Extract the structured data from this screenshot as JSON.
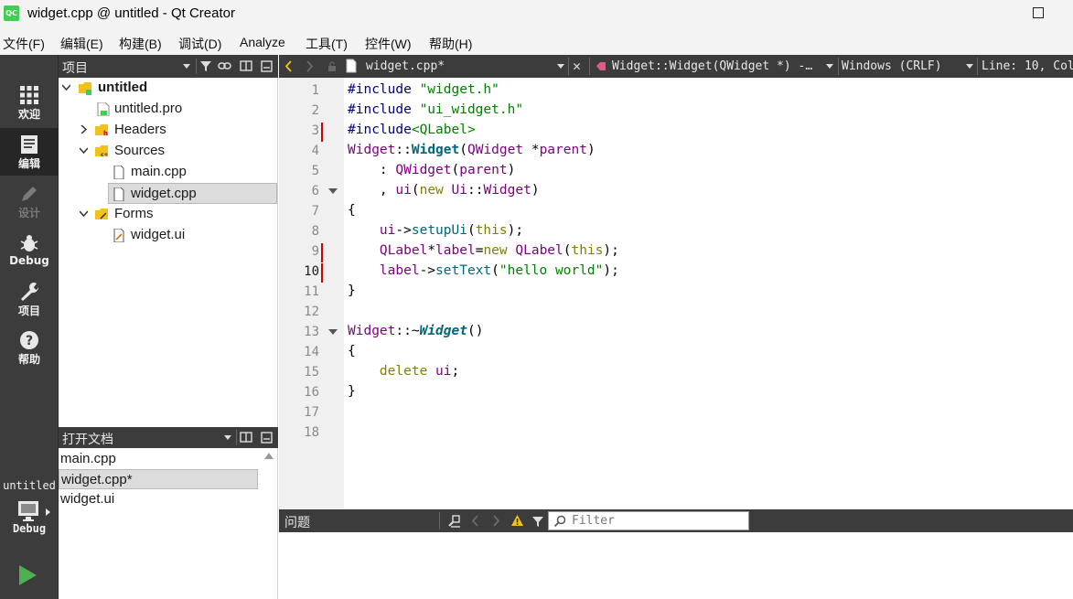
{
  "window": {
    "logo_text": "QC",
    "title": "widget.cpp @ untitled - Qt Creator"
  },
  "menu": [
    "文件(F)",
    "编辑(E)",
    "构建(B)",
    "调试(D)",
    "Analyze",
    "工具(T)",
    "控件(W)",
    "帮助(H)"
  ],
  "modes": {
    "welcome": "欢迎",
    "edit": "编辑",
    "design": "设计",
    "debug": "Debug",
    "projects": "项目",
    "help": "帮助"
  },
  "kit": {
    "project": "untitled",
    "config": "Debug"
  },
  "project_pane": {
    "title": "项目",
    "tree": [
      {
        "label": "untitled",
        "level": 0,
        "expanded": true,
        "icon": "folder-icon"
      },
      {
        "label": "untitled.pro",
        "level": 1,
        "icon": "pro-file-icon"
      },
      {
        "label": "Headers",
        "level": 1,
        "expanded": false,
        "icon": "header-folder-icon"
      },
      {
        "label": "Sources",
        "level": 1,
        "expanded": true,
        "icon": "source-folder-icon"
      },
      {
        "label": "main.cpp",
        "level": 2,
        "icon": "file-icon"
      },
      {
        "label": "widget.cpp",
        "level": 2,
        "icon": "file-icon",
        "selected": true
      },
      {
        "label": "Forms",
        "level": 1,
        "expanded": true,
        "icon": "forms-folder-icon"
      },
      {
        "label": "widget.ui",
        "level": 2,
        "icon": "ui-file-icon"
      }
    ]
  },
  "open_docs": {
    "title": "打开文档",
    "items": [
      {
        "label": "main.cpp"
      },
      {
        "label": "widget.cpp*",
        "selected": true
      },
      {
        "label": "widget.ui"
      }
    ]
  },
  "editor": {
    "file_tab": "widget.cpp*",
    "symbol": "Widget::Widget(QWidget *) -…",
    "line_ending": "Windows (CRLF)",
    "position": "Line: 10, Col:",
    "current_line": 10,
    "line_numbers": [
      "1",
      "2",
      "3",
      "4",
      "5",
      "6",
      "7",
      "8",
      "9",
      "10",
      "11",
      "12",
      "13",
      "14",
      "15",
      "16",
      "17",
      "18"
    ]
  },
  "issues": {
    "title": "问题",
    "filter_placeholder": "Filter"
  }
}
